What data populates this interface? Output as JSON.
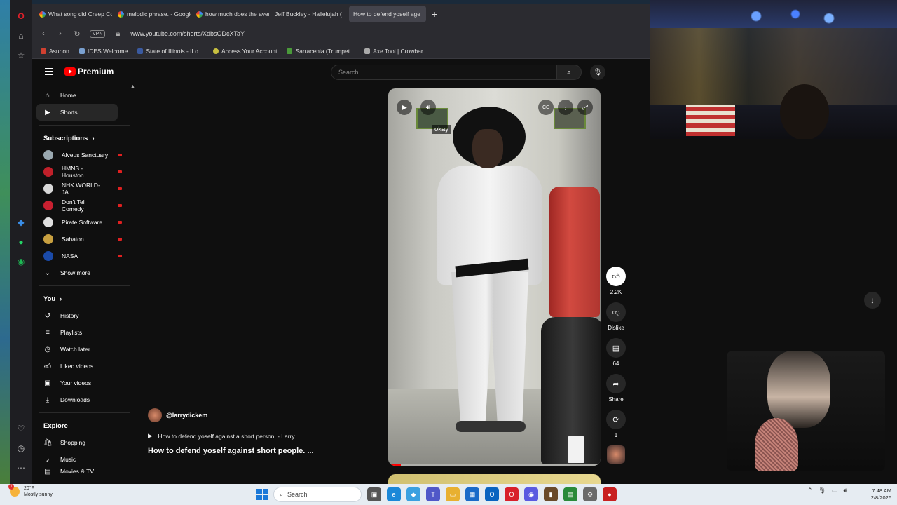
{
  "browser": {
    "tabs": [
      {
        "title": "What song did Creep Cop",
        "icon": "google-icon"
      },
      {
        "title": "melodic phrase. - Google",
        "icon": "google-icon"
      },
      {
        "title": "how much does the avera",
        "icon": "google-icon"
      },
      {
        "title": "Jeff Buckley - Hallelujah (",
        "icon": "youtube-icon"
      },
      {
        "title": "How to defend yoself age",
        "icon": "youtube-icon",
        "active": true
      }
    ],
    "vpn_label": "VPN",
    "url": "www.youtube.com/shorts/XdbsODcXTaY",
    "bookmarks": [
      "Asurion",
      "IDES Welcome",
      "State of Illinois - ILo...",
      "Access Your Account",
      "Sarracenia (Trumpet...",
      "Axe Tool | Crowbar..."
    ]
  },
  "youtube": {
    "logo_text": "Premium",
    "search_placeholder": "Search",
    "guide": {
      "main": [
        {
          "label": "Home",
          "icon": "home-icon"
        },
        {
          "label": "Shorts",
          "icon": "shorts-icon",
          "active": true
        }
      ],
      "subscriptions_title": "Subscriptions",
      "subscriptions": [
        {
          "label": "Alveus Sanctuary",
          "color": "#9aa8b0"
        },
        {
          "label": "HMNS - Houston...",
          "color": "#c0202a"
        },
        {
          "label": "NHK WORLD-JA...",
          "color": "#d8d8d8"
        },
        {
          "label": "Don't Tell Comedy",
          "color": "#c82030"
        },
        {
          "label": "Pirate Software",
          "color": "#e0e0e0"
        },
        {
          "label": "Sabaton",
          "color": "#c8a040"
        },
        {
          "label": "NASA",
          "color": "#1a4aa8"
        }
      ],
      "show_more": "Show more",
      "you_title": "You",
      "you": [
        {
          "label": "History",
          "icon": "history-icon"
        },
        {
          "label": "Playlists",
          "icon": "playlists-icon"
        },
        {
          "label": "Watch later",
          "icon": "watch-later-icon"
        },
        {
          "label": "Liked videos",
          "icon": "thumbs-up-icon"
        },
        {
          "label": "Your videos",
          "icon": "your-videos-icon"
        },
        {
          "label": "Downloads",
          "icon": "download-icon"
        }
      ],
      "explore_title": "Explore",
      "explore": [
        {
          "label": "Shopping",
          "icon": "shopping-icon"
        },
        {
          "label": "Music",
          "icon": "music-icon"
        },
        {
          "label": "Movies & TV",
          "icon": "movies-icon"
        }
      ]
    },
    "short": {
      "caption": "okay",
      "cc_label": "CC",
      "channel": "@larrydickem",
      "linked_video": "How to defend yoself against a short person. - Larry ...",
      "title": "How to defend yoself against short people. ...",
      "progress": 0.06,
      "actions": [
        {
          "name": "like",
          "label": "2.2K",
          "icon": "thumbs-up-icon"
        },
        {
          "name": "dislike",
          "label": "Dislike",
          "icon": "thumbs-down-icon"
        },
        {
          "name": "comments",
          "label": "64",
          "icon": "comment-icon"
        },
        {
          "name": "share",
          "label": "Share",
          "icon": "share-icon"
        },
        {
          "name": "remix",
          "label": "1",
          "icon": "remix-icon"
        }
      ]
    }
  },
  "taskbar": {
    "weather_temp": "20°F",
    "weather_desc": "Mostly sunny",
    "weather_badge": "1",
    "search_label": "Search",
    "time": "7:48 AM",
    "date": "2/8/2026"
  }
}
